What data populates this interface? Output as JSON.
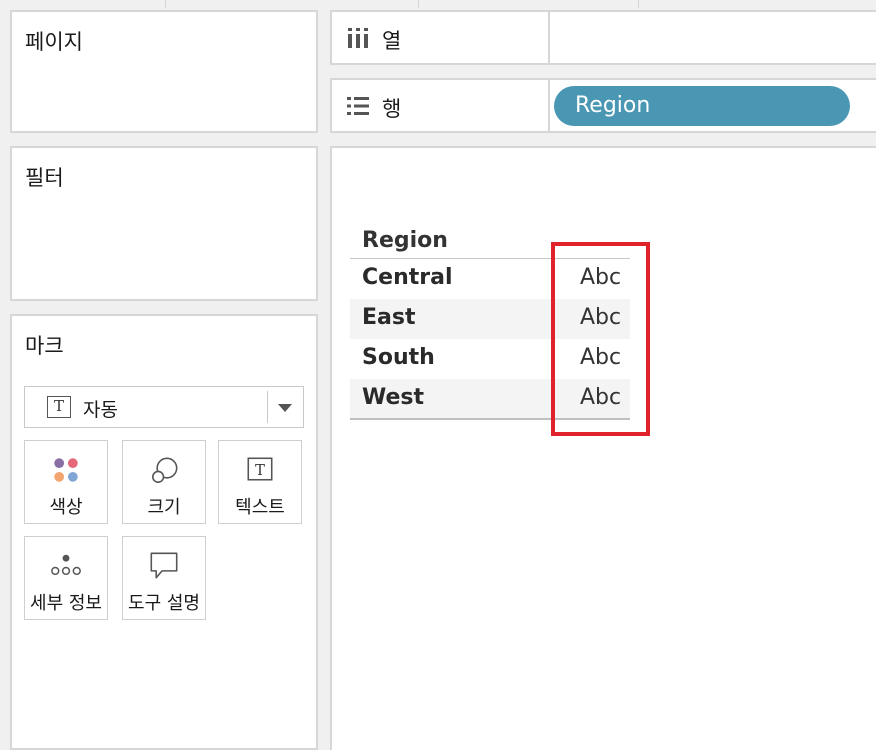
{
  "panels": {
    "pages": {
      "title": "페이지"
    },
    "filters": {
      "title": "필터"
    },
    "marks": {
      "title": "마크",
      "mark_type": {
        "label": "자동",
        "icon": "text-t-icon"
      },
      "buttons": [
        {
          "label": "색상",
          "icon": "color-icon"
        },
        {
          "label": "크기",
          "icon": "size-icon"
        },
        {
          "label": "텍스트",
          "icon": "text-t-icon"
        },
        {
          "label": "세부 정보",
          "icon": "detail-icon"
        },
        {
          "label": "도구 설명",
          "icon": "tooltip-icon"
        }
      ]
    }
  },
  "shelves": {
    "columns": {
      "label": "열",
      "icon": "columns-icon",
      "pills": []
    },
    "rows": {
      "label": "행",
      "icon": "rows-icon",
      "pills": [
        "Region"
      ]
    }
  },
  "view": {
    "table": {
      "header": "Region",
      "rows": [
        {
          "region": "Central",
          "mark": "Abc"
        },
        {
          "region": "East",
          "mark": "Abc"
        },
        {
          "region": "South",
          "mark": "Abc"
        },
        {
          "region": "West",
          "mark": "Abc"
        }
      ]
    },
    "highlight_color": "#e0222a"
  },
  "colors": {
    "pill": "#4a97b3",
    "panel_border": "#d6d6d6",
    "background": "#f0f0f0"
  }
}
